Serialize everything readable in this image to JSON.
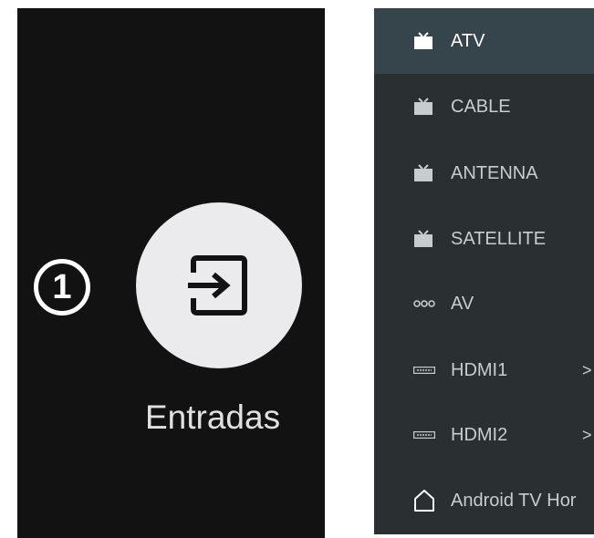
{
  "left": {
    "step_number": "1",
    "input_label": "Entradas",
    "icon": "input-icon"
  },
  "menu": {
    "items": [
      {
        "label": "ATV",
        "icon": "tv-icon",
        "selected": true
      },
      {
        "label": "CABLE",
        "icon": "tv-icon"
      },
      {
        "label": "ANTENNA",
        "icon": "tv-icon"
      },
      {
        "label": "SATELLITE",
        "icon": "tv-icon"
      },
      {
        "label": "AV",
        "icon": "av-dots-icon"
      },
      {
        "label": "HDMI1",
        "icon": "hdmi-icon",
        "chevron": ">"
      },
      {
        "label": "HDMI2",
        "icon": "hdmi-icon",
        "chevron": ">"
      },
      {
        "label": "Android TV Hor",
        "icon": "home-icon"
      }
    ]
  },
  "colors": {
    "left_bg": "#121212",
    "right_bg": "#2a2f32",
    "selected_bg": "#36444b",
    "circle_bg": "#ebebee"
  }
}
